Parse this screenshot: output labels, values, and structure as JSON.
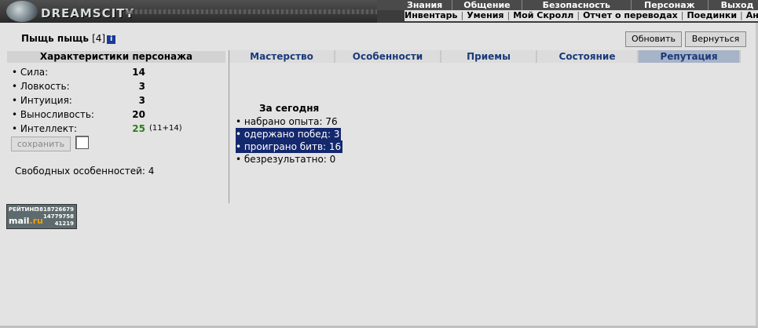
{
  "brand": {
    "logo_text": "DREAMSCITY"
  },
  "nav_top": [
    "Знания",
    "Общение",
    "Безопасность",
    "Персонаж",
    "Выход"
  ],
  "nav_sub": [
    "Инвентарь",
    "Умения",
    "Мой Скролл",
    "Отчет о переводах",
    "Поединки",
    "Анкета"
  ],
  "character": {
    "name": "Пыщь пыщь",
    "level": "[4]",
    "info_icon": "i"
  },
  "buttons": {
    "refresh": "Обновить",
    "back": "Вернуться",
    "save": "сохранить"
  },
  "left_panel": {
    "title": "Характеристики персонажа",
    "stats": [
      {
        "label": "• Сила:",
        "value": "14",
        "extra": ""
      },
      {
        "label": "• Ловкость:",
        "value": "3",
        "extra": ""
      },
      {
        "label": "• Интуиция:",
        "value": "3",
        "extra": ""
      },
      {
        "label": "• Выносливость:",
        "value": "20",
        "extra": ""
      },
      {
        "label": "• Интеллект:",
        "value": "25",
        "extra": "(11+14)"
      }
    ],
    "free_points": "Свободных особенностей: 4"
  },
  "tabs": [
    "Мастерство",
    "Особенности",
    "Приемы",
    "Состояние",
    "Репутация"
  ],
  "active_tab": "Репутация",
  "today": {
    "heading": "За сегодня",
    "items": [
      "• набрано опыта: 76",
      "• одержано побед: 3",
      "• проиграно битв: 16",
      "• безрезультатно: 0"
    ]
  },
  "counter": {
    "label": "РЕЙТИНГ",
    "num1": "3818726679",
    "num2": "14779758",
    "num3": "41219",
    "mail": "mail",
    "ru": ".ru"
  },
  "colors": {
    "active_tab": "#a7b3c7",
    "tab_text": "#1a3a7a",
    "highlight": "#14286e",
    "green_value": "#2e7d1e"
  }
}
